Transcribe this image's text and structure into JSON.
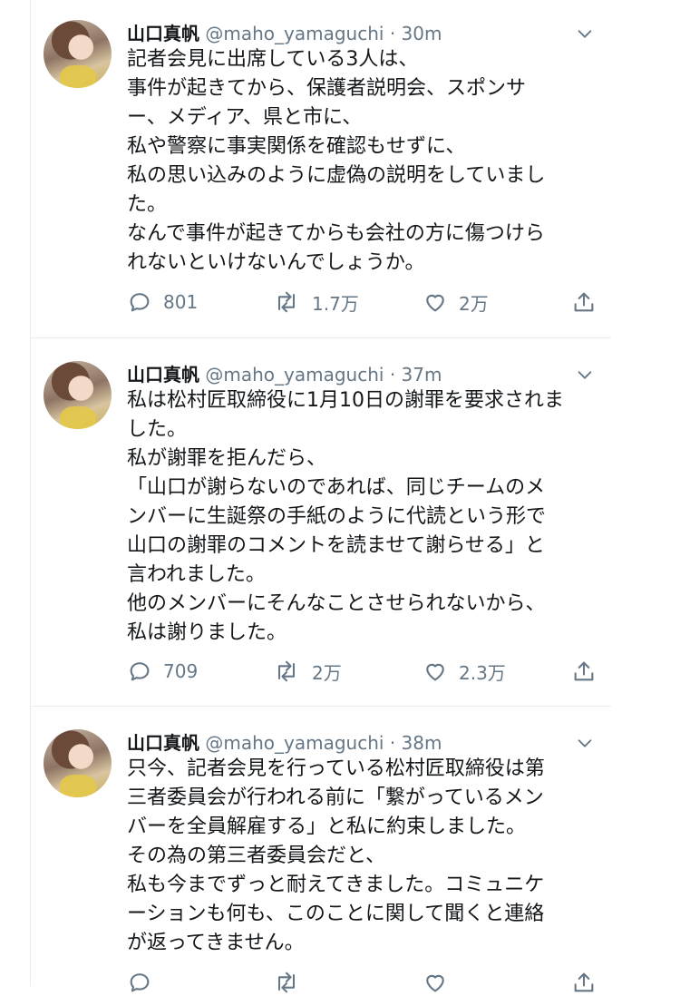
{
  "tweets": [
    {
      "name": "山口真帆",
      "handle": "@maho_yamaguchi",
      "time": "30m",
      "body": "記者会見に出席している3人は、\n事件が起きてから、保護者説明会、スポンサ\nー、メディア、県と市に、\n私や警察に事実関係を確認もせずに、\n私の思い込みのように虚偽の説明をしていまし\nた。\nなんで事件が起きてからも会社の方に傷つけら\nれないといけないんでしょうか。",
      "replies": "801",
      "retweets": "1.7万",
      "likes": "2万"
    },
    {
      "name": "山口真帆",
      "handle": "@maho_yamaguchi",
      "time": "37m",
      "body": "私は松村匠取締役に1月10日の謝罪を要求されま\nした。\n私が謝罪を拒んだら、\n「山口が謝らないのであれば、同じチームのメ\nンバーに生誕祭の手紙のように代読という形で\n山口の謝罪のコメントを読ませて謝らせる」と\n言われました。\n他のメンバーにそんなことさせられないから、\n私は謝りました。",
      "replies": "709",
      "retweets": "2万",
      "likes": "2.3万"
    },
    {
      "name": "山口真帆",
      "handle": "@maho_yamaguchi",
      "time": "38m",
      "body": "只今、記者会見を行っている松村匠取締役は第\n三者委員会が行われる前に「繋がっているメン\nバーを全員解雇する」と私に約束しました。\nその為の第三者委員会だと、\n私も今までずっと耐えてきました。コミュニケ\nーションも何も、このことに関して聞くと連絡\nが返ってきません。",
      "replies": "",
      "retweets": "",
      "likes": ""
    }
  ],
  "separator": "·",
  "icons": {
    "avatar": "profile-photo",
    "menu": "chevron-down-icon",
    "reply": "reply-icon",
    "retweet": "retweet-icon",
    "like": "heart-icon",
    "share": "share-icon"
  },
  "colors": {
    "text": "#14171a",
    "secondary": "#657786",
    "divider": "#e6ecf0"
  }
}
